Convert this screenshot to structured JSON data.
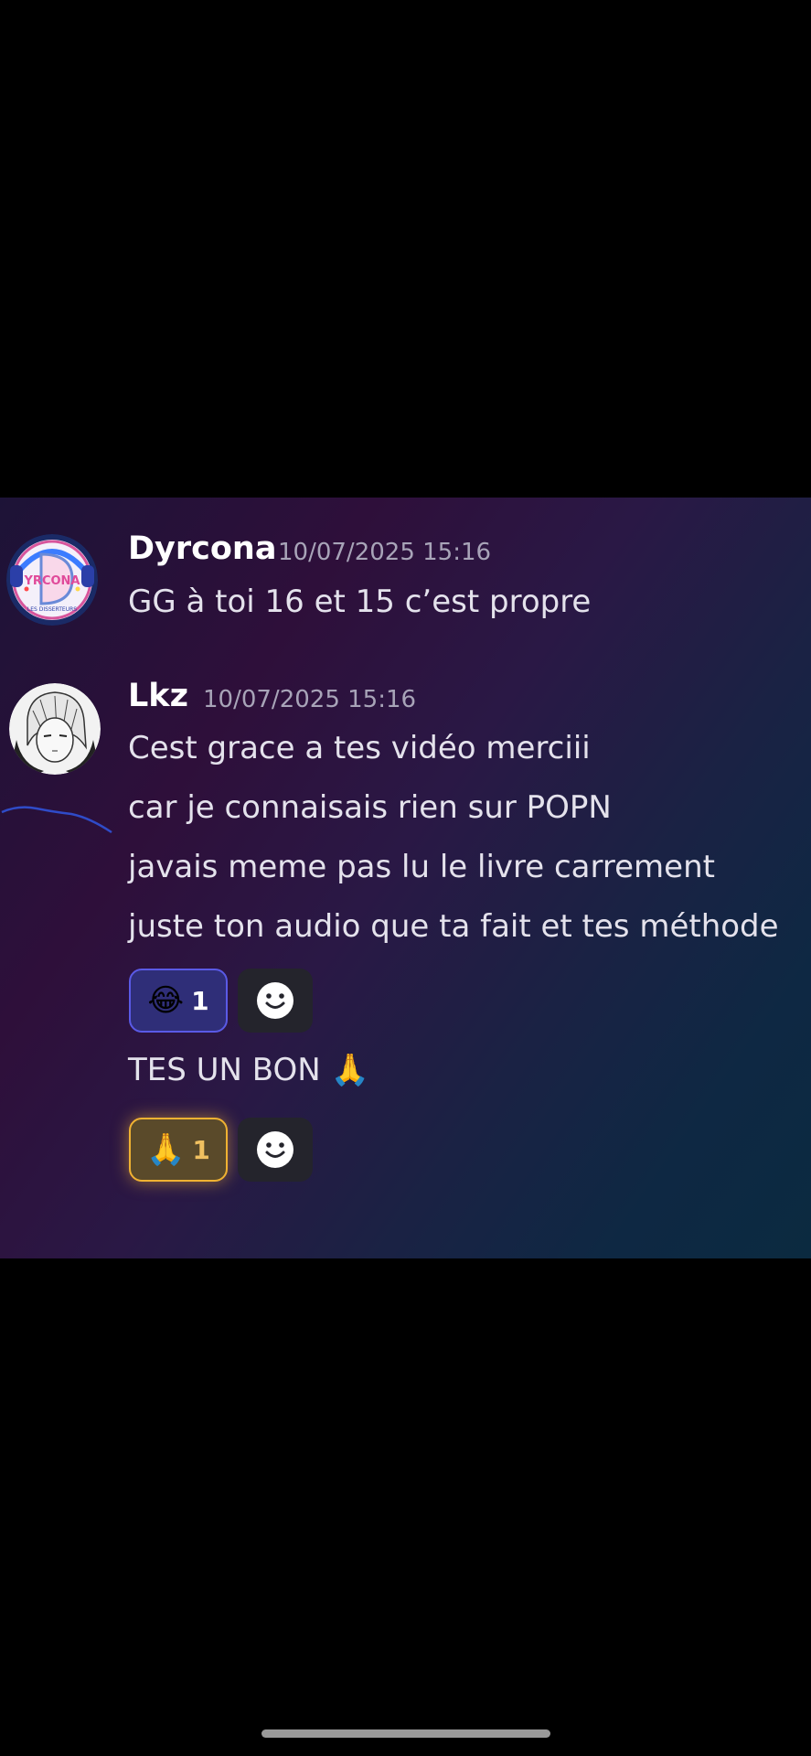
{
  "messages": [
    {
      "author": "Dyrcona",
      "timestamp": "10/07/2025 15:16",
      "lines": [
        "GG à toi 16 et 15 c’est propre"
      ]
    },
    {
      "author": "Lkz",
      "timestamp": "10/07/2025 15:16",
      "lines": [
        "Cest grace a tes vidéo merciii",
        "car je connaisais rien sur POPN",
        "javais meme pas lu le livre carrement",
        "juste ton audio que ta fait et tes méthode"
      ],
      "reaction": {
        "emoji": "😂",
        "count": "1"
      },
      "followup": {
        "text": "TES UN BON",
        "reaction": {
          "emoji": "🙏",
          "count": "1"
        }
      }
    }
  ],
  "avatar_1": {
    "badge_text": "YRCONA",
    "sub_text": "LES DISSERTEURS"
  },
  "colors": {
    "laugh_reaction_border": "#5a5ae6",
    "pray_reaction_border": "#f0b232"
  },
  "icons": [
    "dyrcona-avatar",
    "lkz-avatar",
    "add-reaction-icon",
    "laugh-emoji-icon",
    "pray-emoji-icon"
  ]
}
